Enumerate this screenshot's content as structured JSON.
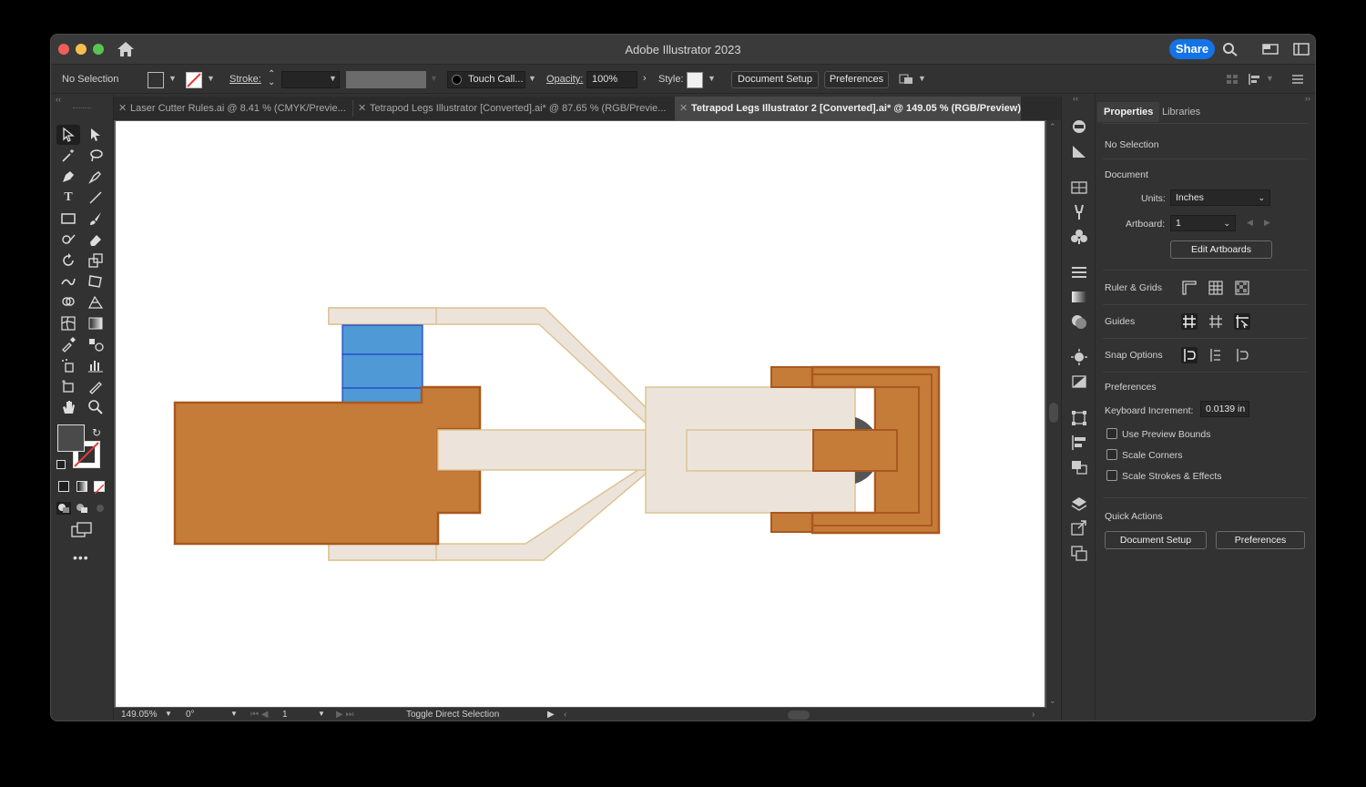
{
  "app": {
    "title": "Adobe Illustrator 2023",
    "share_label": "Share"
  },
  "controlbar": {
    "selection": "No Selection",
    "stroke_label": "Stroke:",
    "brush_label": "Touch Call...",
    "opacity_label": "Opacity:",
    "opacity_value": "100%",
    "style_label": "Style:",
    "document_setup": "Document Setup",
    "preferences": "Preferences"
  },
  "tabs": [
    {
      "label": "Laser Cutter Rules.ai @ 8.41 % (CMYK/Previe..."
    },
    {
      "label": "Tetrapod Legs Illustrator [Converted].ai* @ 87.65 % (RGB/Previe..."
    },
    {
      "label": "Tetrapod Legs Illustrator 2 [Converted].ai* @ 149.05 % (RGB/Preview)"
    }
  ],
  "statusbar": {
    "zoom": "149.05%",
    "rotation": "0°",
    "artboard_num": "1",
    "hint": "Toggle Direct Selection"
  },
  "properties": {
    "tabs": [
      "Properties",
      "Libraries"
    ],
    "no_selection": "No Selection",
    "document_heading": "Document",
    "units_label": "Units:",
    "units_value": "Inches",
    "artboard_label": "Artboard:",
    "artboard_value": "1",
    "edit_artboards": "Edit Artboards",
    "ruler_grids": "Ruler & Grids",
    "guides": "Guides",
    "snap_options": "Snap Options",
    "preferences_heading": "Preferences",
    "keyboard_increment_label": "Keyboard Increment:",
    "keyboard_increment_value": "0.0139 in",
    "checkboxes": [
      "Use Preview Bounds",
      "Scale Corners",
      "Scale Strokes & Effects"
    ],
    "quick_actions": "Quick Actions",
    "qa_document_setup": "Document Setup",
    "qa_preferences": "Preferences"
  },
  "colors": {
    "accent": "#1473e6",
    "orange": "#c47c38",
    "orange_stroke": "#a9581f",
    "cream": "#ece4da",
    "cream_stroke": "#dcc391",
    "blue": "#4f9ad6"
  }
}
